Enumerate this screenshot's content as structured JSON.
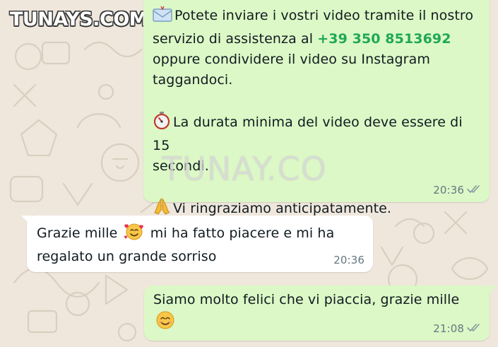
{
  "watermark": {
    "logo_text": "TUNAYS.COM",
    "center_text": "TUNAY.CO"
  },
  "messages": [
    {
      "direction": "outgoing",
      "paragraphs": [
        {
          "icon": "envelope-icon",
          "lines": [
            "Potete inviare i vostri video tramite il nostro",
            "servizio di assistenza al "
          ],
          "phone": "+39 350 8513692",
          "after": [
            "oppure condividere il video su Instagram",
            "taggandoci."
          ]
        },
        {
          "icon": "stopwatch-icon",
          "lines": [
            "La durata minima del video deve essere di 15",
            "secondi."
          ]
        },
        {
          "icon": "praying-hands-icon",
          "lines": [
            "Vi ringraziamo anticipatamente."
          ]
        }
      ],
      "time": "20:36",
      "status": "read-double-check-icon"
    },
    {
      "direction": "incoming",
      "lines": [
        "Grazie mille",
        "mi ha fatto piacere e mi ha",
        "regalato un grande sorriso"
      ],
      "emoji": "smiling-face-with-hearts-icon",
      "time": "20:36"
    },
    {
      "direction": "outgoing",
      "text": "Siamo molto felici che vi piaccia, grazie mille",
      "emoji": "smiling-face-icon",
      "time": "21:08",
      "status": "read-double-check-icon"
    }
  ],
  "colors": {
    "outgoing_bubble": "#dcf8c6",
    "incoming_bubble": "#ffffff",
    "wallpaper": "#efe7dc",
    "phone_link": "#1fa855",
    "timestamp": "#667781"
  }
}
